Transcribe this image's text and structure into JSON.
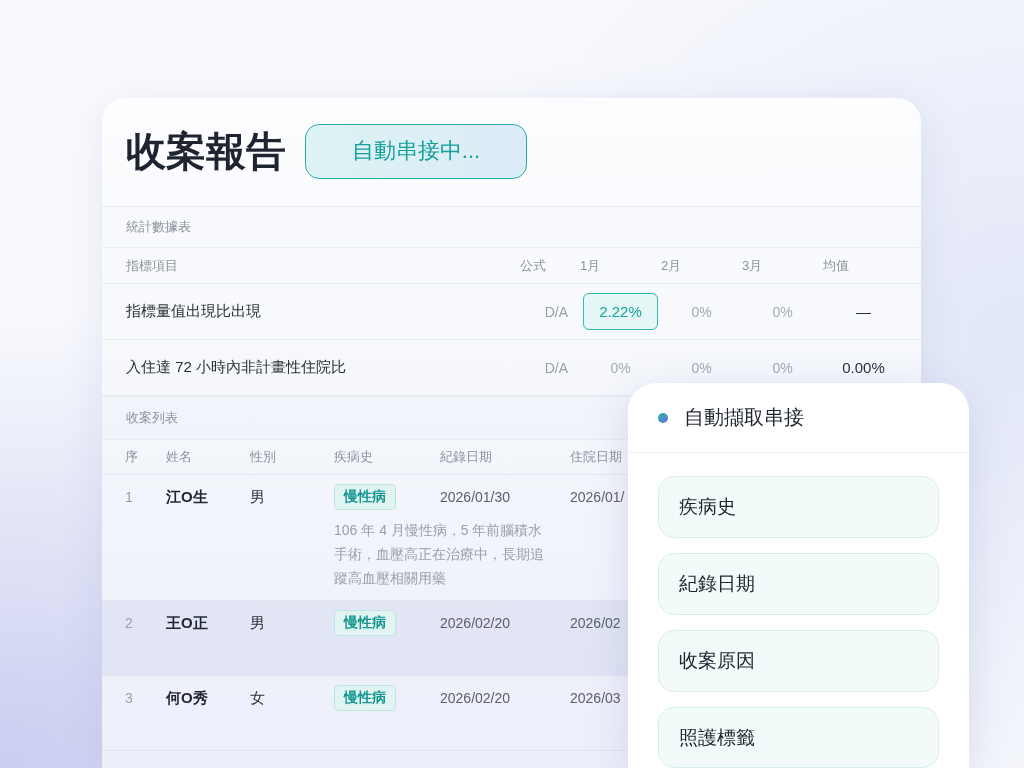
{
  "report": {
    "title": "收案報告",
    "status_badge": "自動串接中..."
  },
  "stats_table": {
    "section_title": "統計數據表",
    "columns": [
      "指標項目",
      "公式",
      "1月",
      "2月",
      "3月",
      "均值"
    ],
    "rows": [
      {
        "indicator": "指標量值出現比出現",
        "formula": "D/A",
        "values": [
          {
            "text": "2.22%",
            "kind": "highlight"
          },
          {
            "text": "0%",
            "kind": "muted"
          },
          {
            "text": "0%",
            "kind": "muted"
          },
          {
            "text": "—",
            "kind": "normal"
          }
        ]
      },
      {
        "indicator": "入住達 72 小時內非計畫性住院比",
        "formula": "D/A",
        "values": [
          {
            "text": "0%",
            "kind": "muted"
          },
          {
            "text": "0%",
            "kind": "muted"
          },
          {
            "text": "0%",
            "kind": "muted"
          },
          {
            "text": "0.00%",
            "kind": "normal"
          }
        ]
      }
    ]
  },
  "case_table": {
    "section_title": "收案列表",
    "columns": [
      "序",
      "姓名",
      "性別",
      "疾病史",
      "紀錄日期",
      "住院日期"
    ],
    "rows": [
      {
        "no": "1",
        "name": "江O生",
        "gender": "男",
        "tag": "慢性病",
        "history_note": "106 年 4 月慢性病，5 年前腦積水手術，血壓高正在治療中，長期追蹤高血壓相關用藥",
        "record_date": "2026/01/30",
        "admission_date": "2026/01/",
        "selected": false
      },
      {
        "no": "2",
        "name": "王O正",
        "gender": "男",
        "tag": "慢性病",
        "record_date": "2026/02/20",
        "admission_date": "2026/02",
        "selected": true
      },
      {
        "no": "3",
        "name": "何O秀",
        "gender": "女",
        "tag": "慢性病",
        "record_date": "2026/02/20",
        "admission_date": "2026/03",
        "selected": false
      }
    ]
  },
  "popup": {
    "title": "自動擷取串接",
    "fields": [
      "疾病史",
      "紀錄日期",
      "收案原因",
      "照護標籤"
    ]
  }
}
